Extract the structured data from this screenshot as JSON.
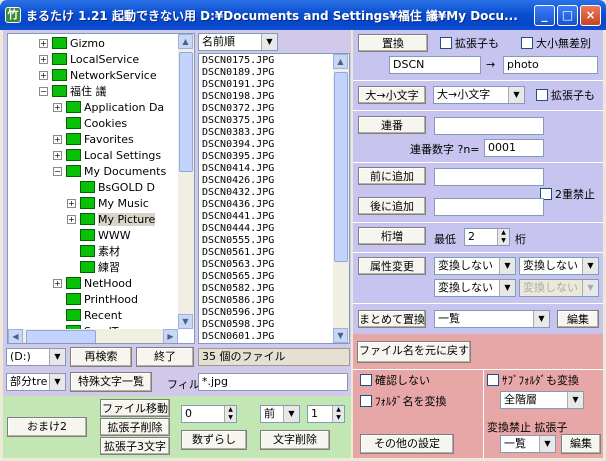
{
  "window": {
    "title": "まるたけ 1.21 起動できない用  D:¥Documents and Settings¥福住  議¥My Docu..."
  },
  "tree": {
    "items": [
      {
        "label": "Gizmo",
        "expander": "+"
      },
      {
        "label": "LocalService",
        "expander": "+"
      },
      {
        "label": "NetworkService",
        "expander": "+"
      },
      {
        "label": "福住 議",
        "expander": "−"
      },
      {
        "label": "Application Da",
        "expander": "+"
      },
      {
        "label": "Cookies",
        "expander": ""
      },
      {
        "label": "Favorites",
        "expander": "+"
      },
      {
        "label": "Local Settings",
        "expander": "+"
      },
      {
        "label": "My Documents",
        "expander": "−"
      },
      {
        "label": "BsGOLD D",
        "expander": ""
      },
      {
        "label": "My Music",
        "expander": "+"
      },
      {
        "label": "My Picture",
        "expander": "+"
      },
      {
        "label": "WWW",
        "expander": ""
      },
      {
        "label": "素材",
        "expander": ""
      },
      {
        "label": "練習",
        "expander": ""
      },
      {
        "label": "NetHood",
        "expander": "+"
      },
      {
        "label": "PrintHood",
        "expander": ""
      },
      {
        "label": "Recent",
        "expander": ""
      },
      {
        "label": "SendTo",
        "expander": ""
      }
    ]
  },
  "sort": {
    "value": "名前順"
  },
  "files": [
    "DSCN0175.JPG",
    "DSCN0189.JPG",
    "DSCN0191.JPG",
    "DSCN0198.JPG",
    "DSCN0372.JPG",
    "DSCN0375.JPG",
    "DSCN0383.JPG",
    "DSCN0394.JPG",
    "DSCN0395.JPG",
    "DSCN0414.JPG",
    "DSCN0426.JPG",
    "DSCN0432.JPG",
    "DSCN0436.JPG",
    "DSCN0441.JPG",
    "DSCN0444.JPG",
    "DSCN0555.JPG",
    "DSCN0561.JPG",
    "DSCN0563.JPG",
    "DSCN0565.JPG",
    "DSCN0582.JPG",
    "DSCN0586.JPG",
    "DSCN0596.JPG",
    "DSCN0598.JPG",
    "DSCN0601.JPG"
  ],
  "bottom": {
    "drive": "(D:)",
    "research": "再検索",
    "exit": "終了",
    "count": "35 個のファイル",
    "partial": "部分tre",
    "special_char": "特殊文字一覧",
    "filter_label": "フィルタ",
    "filter_value": "*.jpg"
  },
  "replace": {
    "button": "置換",
    "ext_label": "拡張子も",
    "case_label": "大小無差別",
    "from": "DSCN",
    "arrow": "→",
    "to": "photo"
  },
  "case": {
    "button": "大→小文字",
    "select": "大→小文字",
    "ext_label": "拡張子も"
  },
  "serial": {
    "button": "連番",
    "digits_label": "連番数字 ?n=",
    "digits_value": "0001"
  },
  "prefix": {
    "button": "前に追加"
  },
  "suffix": {
    "button": "後に追加"
  },
  "double_ban": {
    "label": "2重禁止"
  },
  "digits": {
    "button": "桁増",
    "min_label": "最低",
    "value": "2",
    "unit": "桁"
  },
  "attr": {
    "button": "属性変更",
    "sel1": "変換しない",
    "sel2": "変換しない",
    "sel3": "変換しない",
    "sel4": "変換しない"
  },
  "batch": {
    "button": "まとめて置換",
    "select": "一覧",
    "edit": "編集"
  },
  "restore": {
    "button": "ファイル名を元に戻す"
  },
  "confirm": {
    "label": "確認しない"
  },
  "folder_conv": {
    "label": "ﾌｫﾙﾀﾞ名を変換"
  },
  "subfolder": {
    "label": "ｻﾌﾞﾌｫﾙﾀﾞも変換",
    "select": "全階層"
  },
  "other": {
    "button": "その他の設定"
  },
  "convban": {
    "label": "変換禁止 拡張子",
    "select": "一覧",
    "edit": "編集"
  },
  "extras": {
    "omake": "おまけ2",
    "file_move": "ファイル移動",
    "del_ext": "拡張子削除",
    "ext3": "拡張子3文字",
    "spin_value": "0",
    "shift": "数ずらし",
    "pos_select": "前",
    "count_value": "1",
    "del_char": "文字削除"
  },
  "colors": {
    "left_panel": "#d2c8ea",
    "right_panel": "#c7c4ef",
    "lower_right": "#e8a7a7",
    "bottom_green": "#c2e6b4"
  }
}
